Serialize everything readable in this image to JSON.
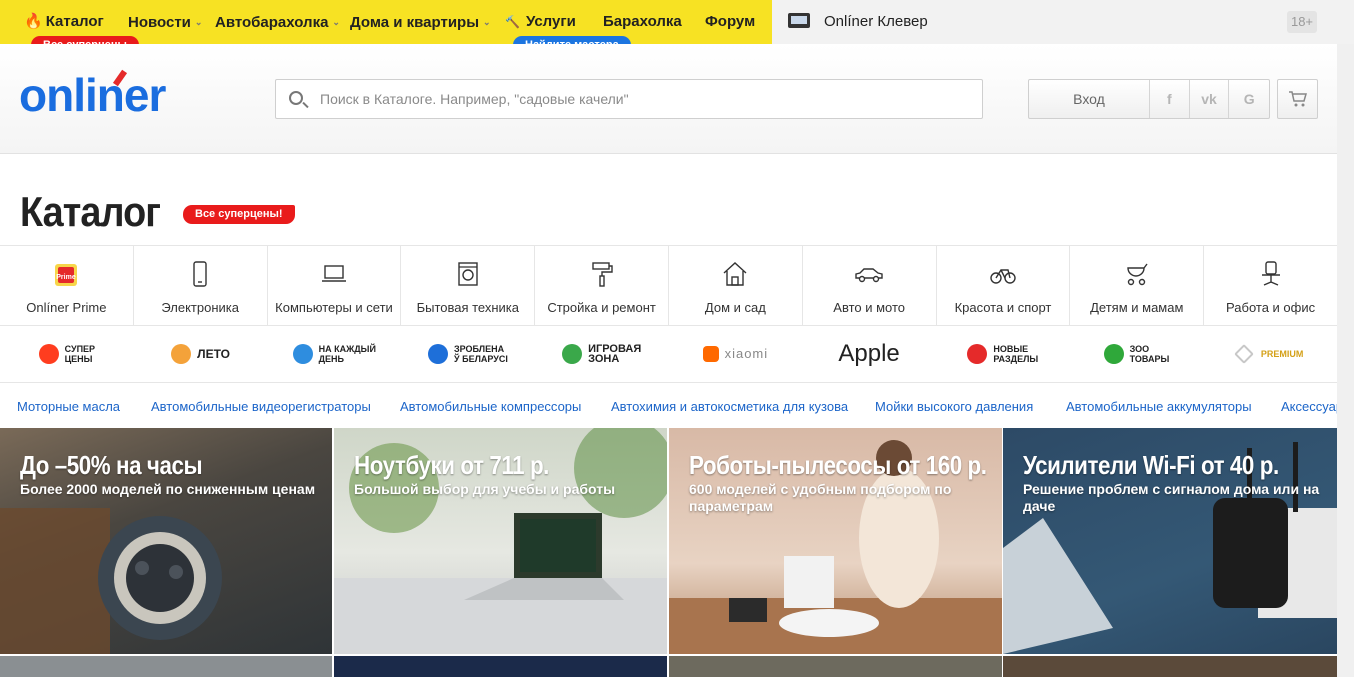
{
  "topnav": {
    "items": [
      {
        "label": "Каталог"
      },
      {
        "label": "Новости"
      },
      {
        "label": "Автобарахолка"
      },
      {
        "label": "Дома и квартиры"
      },
      {
        "label": "Услуги"
      },
      {
        "label": "Барахолка"
      },
      {
        "label": "Форум"
      }
    ],
    "catalog_badge": "Все суперцены",
    "services_badge": "Найдите мастера",
    "clever": "Onlíner Клевер",
    "age": "18+"
  },
  "header": {
    "logo": "onliner",
    "search_placeholder": "Поиск в Каталоге. Например, \"садовые качели\"",
    "login": "Вход",
    "social": [
      "f",
      "vk",
      "G"
    ]
  },
  "catalog": {
    "title": "Каталог",
    "badge": "Все суперцены!"
  },
  "categories": [
    {
      "label": "Onlíner Prime",
      "icon": "prime-icon"
    },
    {
      "label": "Электроника",
      "icon": "phone-icon"
    },
    {
      "label": "Компьютеры и сети",
      "icon": "laptop-icon"
    },
    {
      "label": "Бытовая техника",
      "icon": "washer-icon"
    },
    {
      "label": "Стройка и ремонт",
      "icon": "paint-roller-icon"
    },
    {
      "label": "Дом и сад",
      "icon": "house-icon"
    },
    {
      "label": "Авто и мото",
      "icon": "car-icon"
    },
    {
      "label": "Красота и спорт",
      "icon": "bicycle-icon"
    },
    {
      "label": "Детям и мамам",
      "icon": "stroller-icon"
    },
    {
      "label": "Работа и офис",
      "icon": "office-chair-icon"
    }
  ],
  "promos": [
    {
      "text": "Супер\nцены",
      "color": "#ff3d1f"
    },
    {
      "text": "Лето",
      "color": "#f4a23a"
    },
    {
      "text": "На каждый\nдень",
      "color": "#2e8ddf"
    },
    {
      "text": "Зроблена\nў Беларусі",
      "color": "#1e6fd9"
    },
    {
      "text": "Игровая\nзона",
      "color": "#3aa84a"
    },
    {
      "text": "xiaomi",
      "color": "#ff6900"
    },
    {
      "text": "Apple",
      "color": "#000000"
    },
    {
      "text": "Новые\nразделы",
      "color": "#e52a2a"
    },
    {
      "text": "Зоо\nтовары",
      "color": "#2fa83a"
    },
    {
      "text": "Premium",
      "color": "#d4a017"
    }
  ],
  "links": [
    "Моторные масла",
    "Автомобильные видеорегистраторы",
    "Автомобильные компрессоры",
    "Автохимия и автокосметика для кузова",
    "Мойки высокого давления",
    "Автомобильные аккумуляторы",
    "Аксессуары"
  ],
  "tiles": [
    {
      "title": "До –50% на часы",
      "subtitle": "Более 2000 моделей по сниженным ценам"
    },
    {
      "title": "Ноутбуки от 711 р.",
      "subtitle": "Большой выбор для учебы и работы"
    },
    {
      "title": "Роботы-пылесосы от 160 р.",
      "subtitle": "600 моделей с удобным подбором по параметрам"
    },
    {
      "title": "Усилители Wi-Fi от 40 р.",
      "subtitle": "Решение проблем с сигналом дома или на даче"
    }
  ]
}
